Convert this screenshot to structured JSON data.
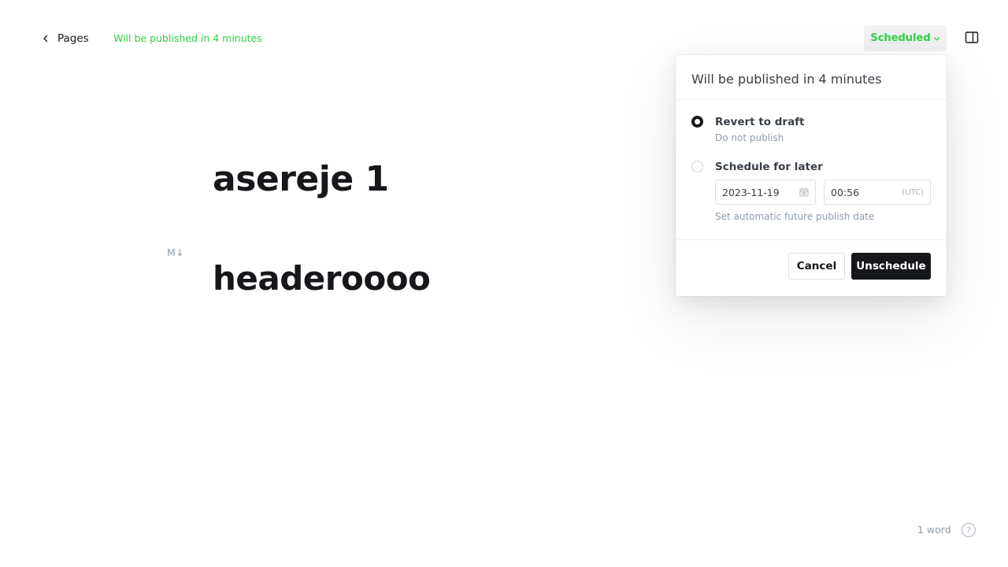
{
  "header": {
    "back_label": "Pages",
    "status_text": "Will be published in 4 minutes",
    "status_button_label": "Scheduled"
  },
  "editor": {
    "title": "asereje 1",
    "markdown_badge": "M↓",
    "heading": "headeroooo"
  },
  "footer": {
    "word_count": "1 word",
    "help_label": "?"
  },
  "popover": {
    "title": "Will be published in 4 minutes",
    "options": [
      {
        "label": "Revert to draft",
        "sub": "Do not publish",
        "checked": true
      },
      {
        "label": "Schedule for later",
        "checked": false
      }
    ],
    "date_value": "2023-11-19",
    "time_value": "00:56",
    "timezone": "(UTC)",
    "hint": "Set automatic future publish date",
    "cancel_label": "Cancel",
    "confirm_label": "Unschedule"
  },
  "colors": {
    "accent_green": "#30cf43",
    "text_dark": "#15171a",
    "muted": "#8e9cac"
  }
}
